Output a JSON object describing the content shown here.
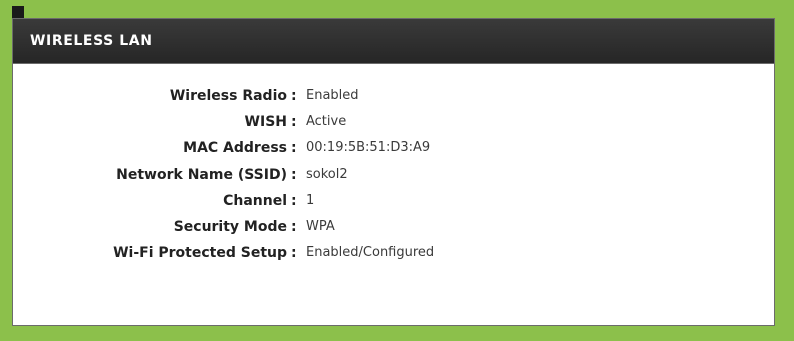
{
  "panel": {
    "title": "WIRELESS LAN"
  },
  "rows": [
    {
      "label": "Wireless Radio",
      "sep": ":",
      "value": "Enabled"
    },
    {
      "label": "WISH",
      "sep": ":",
      "value": "Active"
    },
    {
      "label": "MAC Address",
      "sep": ":",
      "value": "00:19:5B:51:D3:A9"
    },
    {
      "label": "Network Name (SSID)",
      "sep": ":",
      "value": "sokol2"
    },
    {
      "label": "Channel",
      "sep": ":",
      "value": "1"
    },
    {
      "label": "Security Mode",
      "sep": ":",
      "value": "WPA"
    },
    {
      "label": "Wi-Fi Protected Setup",
      "sep": ":",
      "value": "Enabled/Configured"
    }
  ],
  "colors": {
    "frame": "#8cc04b",
    "header": "#2b2b2b",
    "header_text": "#ffffff"
  }
}
